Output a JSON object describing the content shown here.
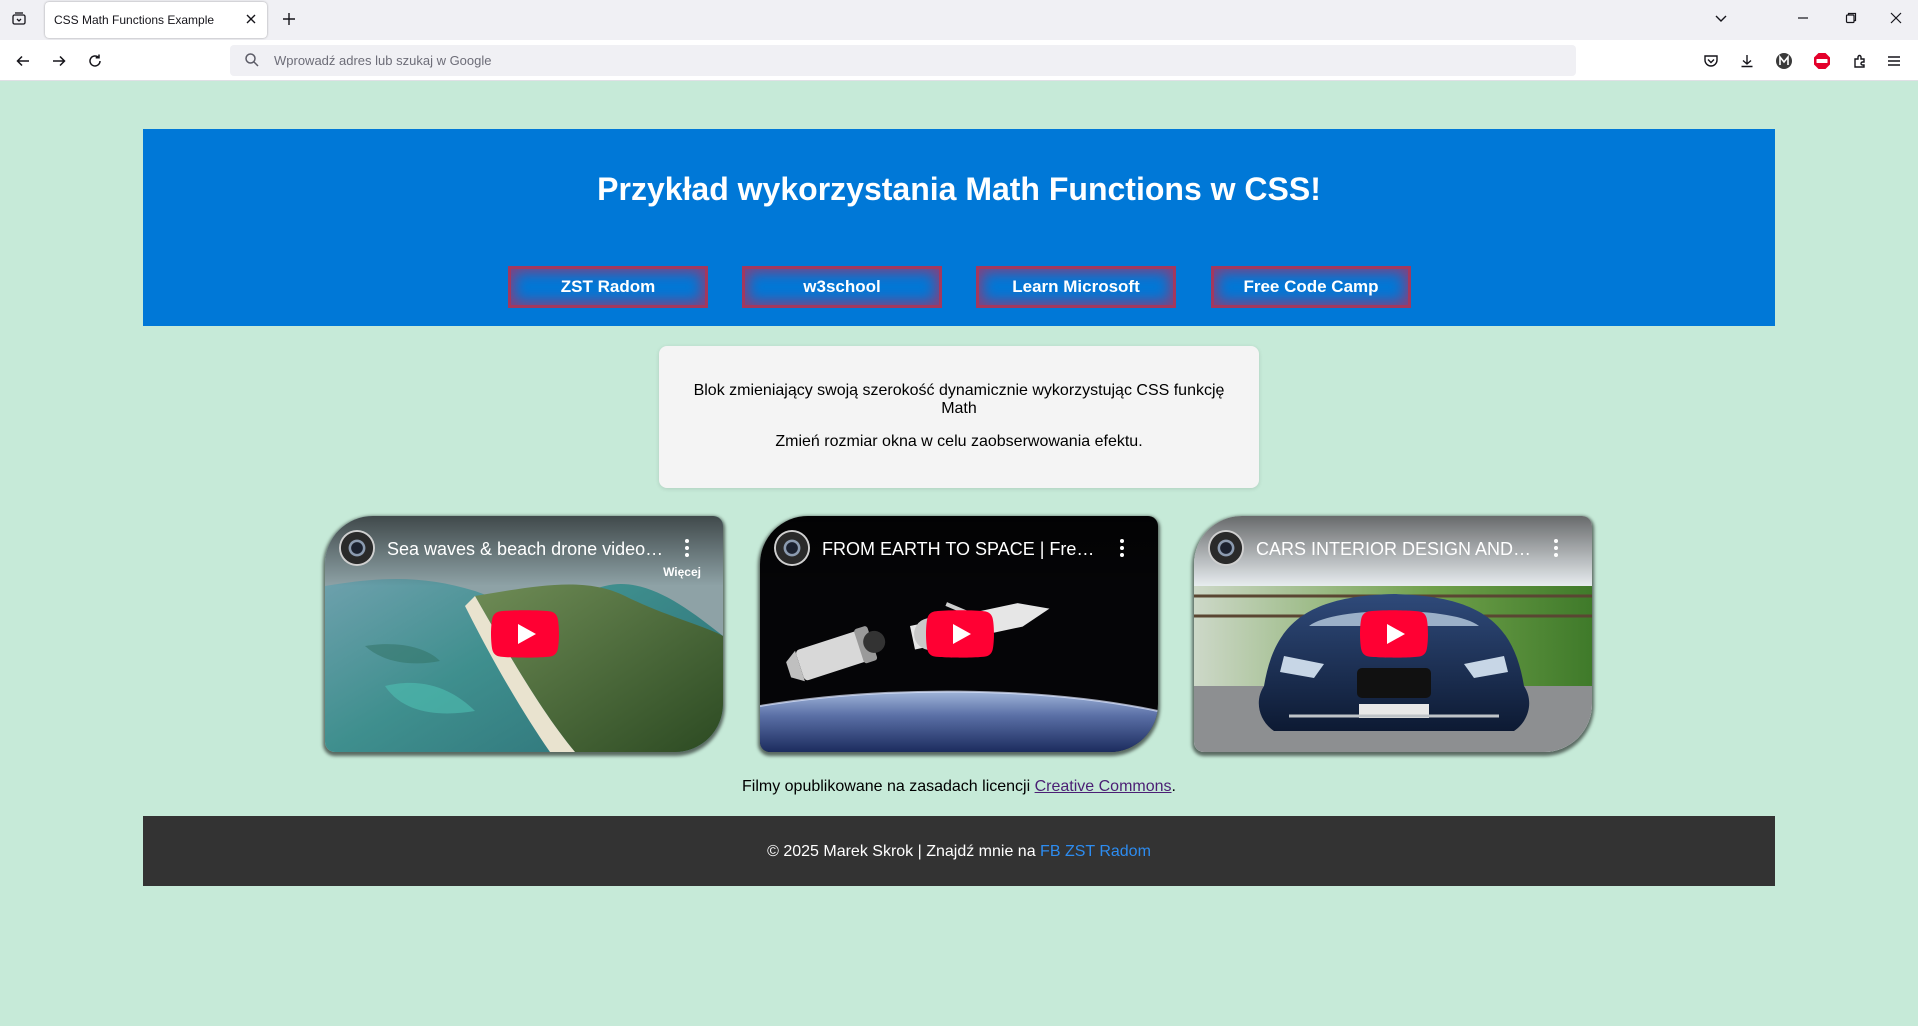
{
  "browser": {
    "tab_title": "CSS Math Functions Example",
    "url_placeholder": "Wprowadź adres lub szukaj w Google"
  },
  "header": {
    "title": "Przykład wykorzystania Math Functions w CSS!",
    "links": [
      "ZST Radom",
      "w3school",
      "Learn Microsoft",
      "Free Code Camp"
    ]
  },
  "info": {
    "line1": "Blok zmieniający swoją szerokość dynamicznie wykorzystując CSS funkcję Math",
    "line2": "Zmień rozmiar okna w celu zaobserwowania efektu."
  },
  "videos": [
    {
      "title": "Sea waves & beach drone video |...",
      "more_label": "Więcej"
    },
    {
      "title": "FROM EARTH TO SPACE | Free H...",
      "more_label": ""
    },
    {
      "title": "CARS INTERIOR DESIGN AND S...",
      "more_label": ""
    }
  ],
  "license": {
    "text": "Filmy opublikowane na zasadach licencji ",
    "link": "Creative Commons",
    "suffix": "."
  },
  "footer": {
    "text": "© 2025 Marek Skrok | Znajdź mnie na ",
    "link": "FB ZST Radom"
  },
  "colors": {
    "page_bg": "#c6ead8",
    "header_bg": "#0078d7",
    "footer_bg": "#333333",
    "footer_link": "#2d8cf0",
    "play_red": "#ff0033"
  },
  "icons": [
    "tab-list-icon",
    "close-icon",
    "plus-icon",
    "chevron-down-icon",
    "minimize-icon",
    "restore-icon",
    "back-arrow-icon",
    "forward-arrow-icon",
    "reload-icon",
    "search-icon",
    "pocket-icon",
    "download-icon",
    "account-icon",
    "adblock-icon",
    "extensions-icon",
    "menu-icon",
    "play-icon",
    "more-vertical-icon"
  ]
}
